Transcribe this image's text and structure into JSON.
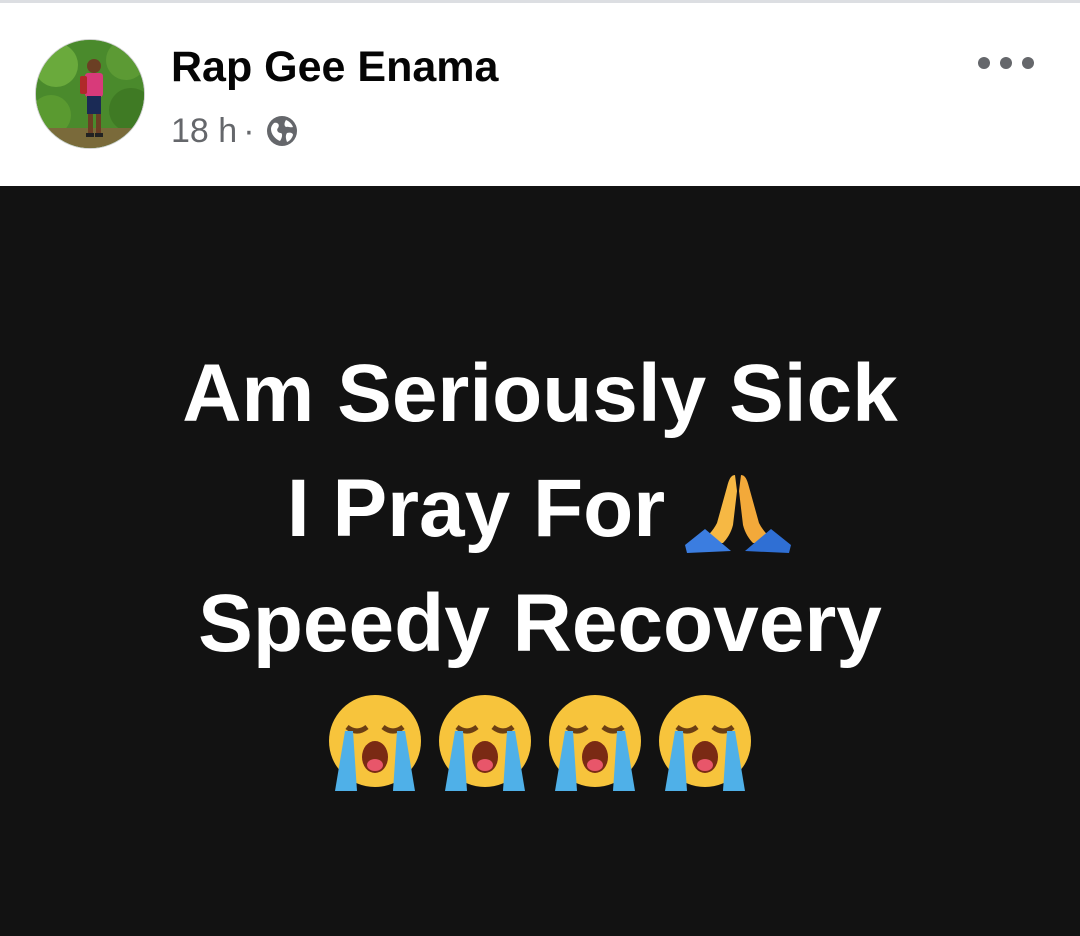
{
  "post": {
    "author_name": "Rap Gee Enama",
    "timestamp": "18 h",
    "separator": "·",
    "privacy_icon": "globe-icon",
    "more_icon": "more-options-icon",
    "text_lines": [
      "Am Seriously Sick",
      "I Pray For",
      "Speedy Recovery"
    ],
    "emoji_praying": "folded-hands-emoji",
    "emoji_crying": [
      "loudly-crying-face-emoji",
      "loudly-crying-face-emoji",
      "loudly-crying-face-emoji",
      "loudly-crying-face-emoji"
    ],
    "background_color": "#121212",
    "text_color": "#ffffff"
  }
}
